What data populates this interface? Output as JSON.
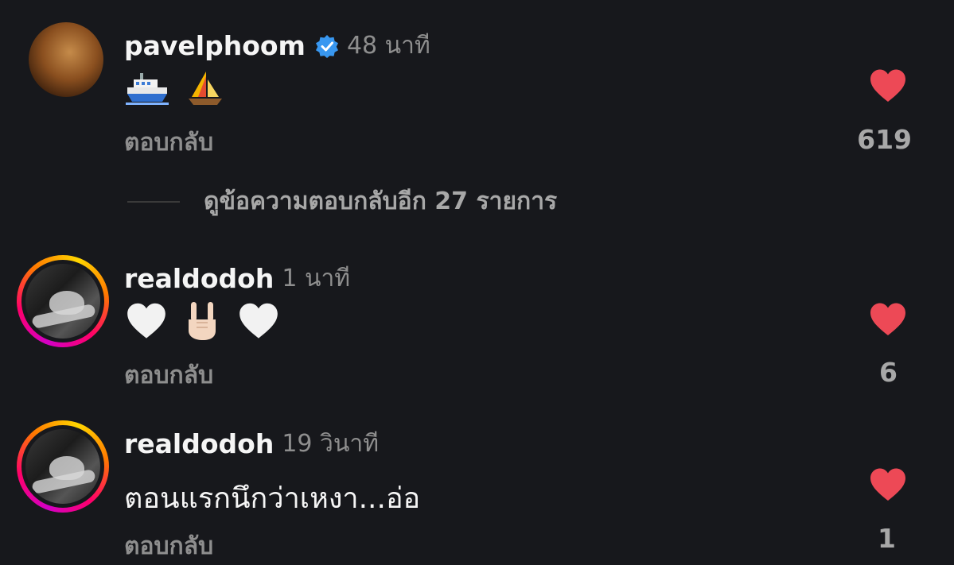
{
  "colors": {
    "background": "#17181c",
    "heart": "#ed4956",
    "verified": "#3897f0",
    "muted": "#8e8e8e"
  },
  "comments": [
    {
      "username": "pavelphoom",
      "verified": true,
      "time": "48 นาที",
      "text_icons": [
        "ferry-icon",
        "sailboat-icon"
      ],
      "reply_label": "ตอบกลับ",
      "likes": "619"
    },
    {
      "username": "realdodoh",
      "verified": false,
      "time": "1 นาที",
      "text_icons": [
        "white-heart-icon",
        "rock-on-hand-icon",
        "white-heart-icon"
      ],
      "reply_label": "ตอบกลับ",
      "likes": "6"
    },
    {
      "username": "realdodoh",
      "verified": false,
      "time": "19 วินาที",
      "text": "ตอนแรกนึกว่าเหงา...อ่อ",
      "reply_label": "ตอบกลับ",
      "likes": "1"
    }
  ],
  "view_replies": "ดูข้อความตอบกลับอีก 27 รายการ"
}
